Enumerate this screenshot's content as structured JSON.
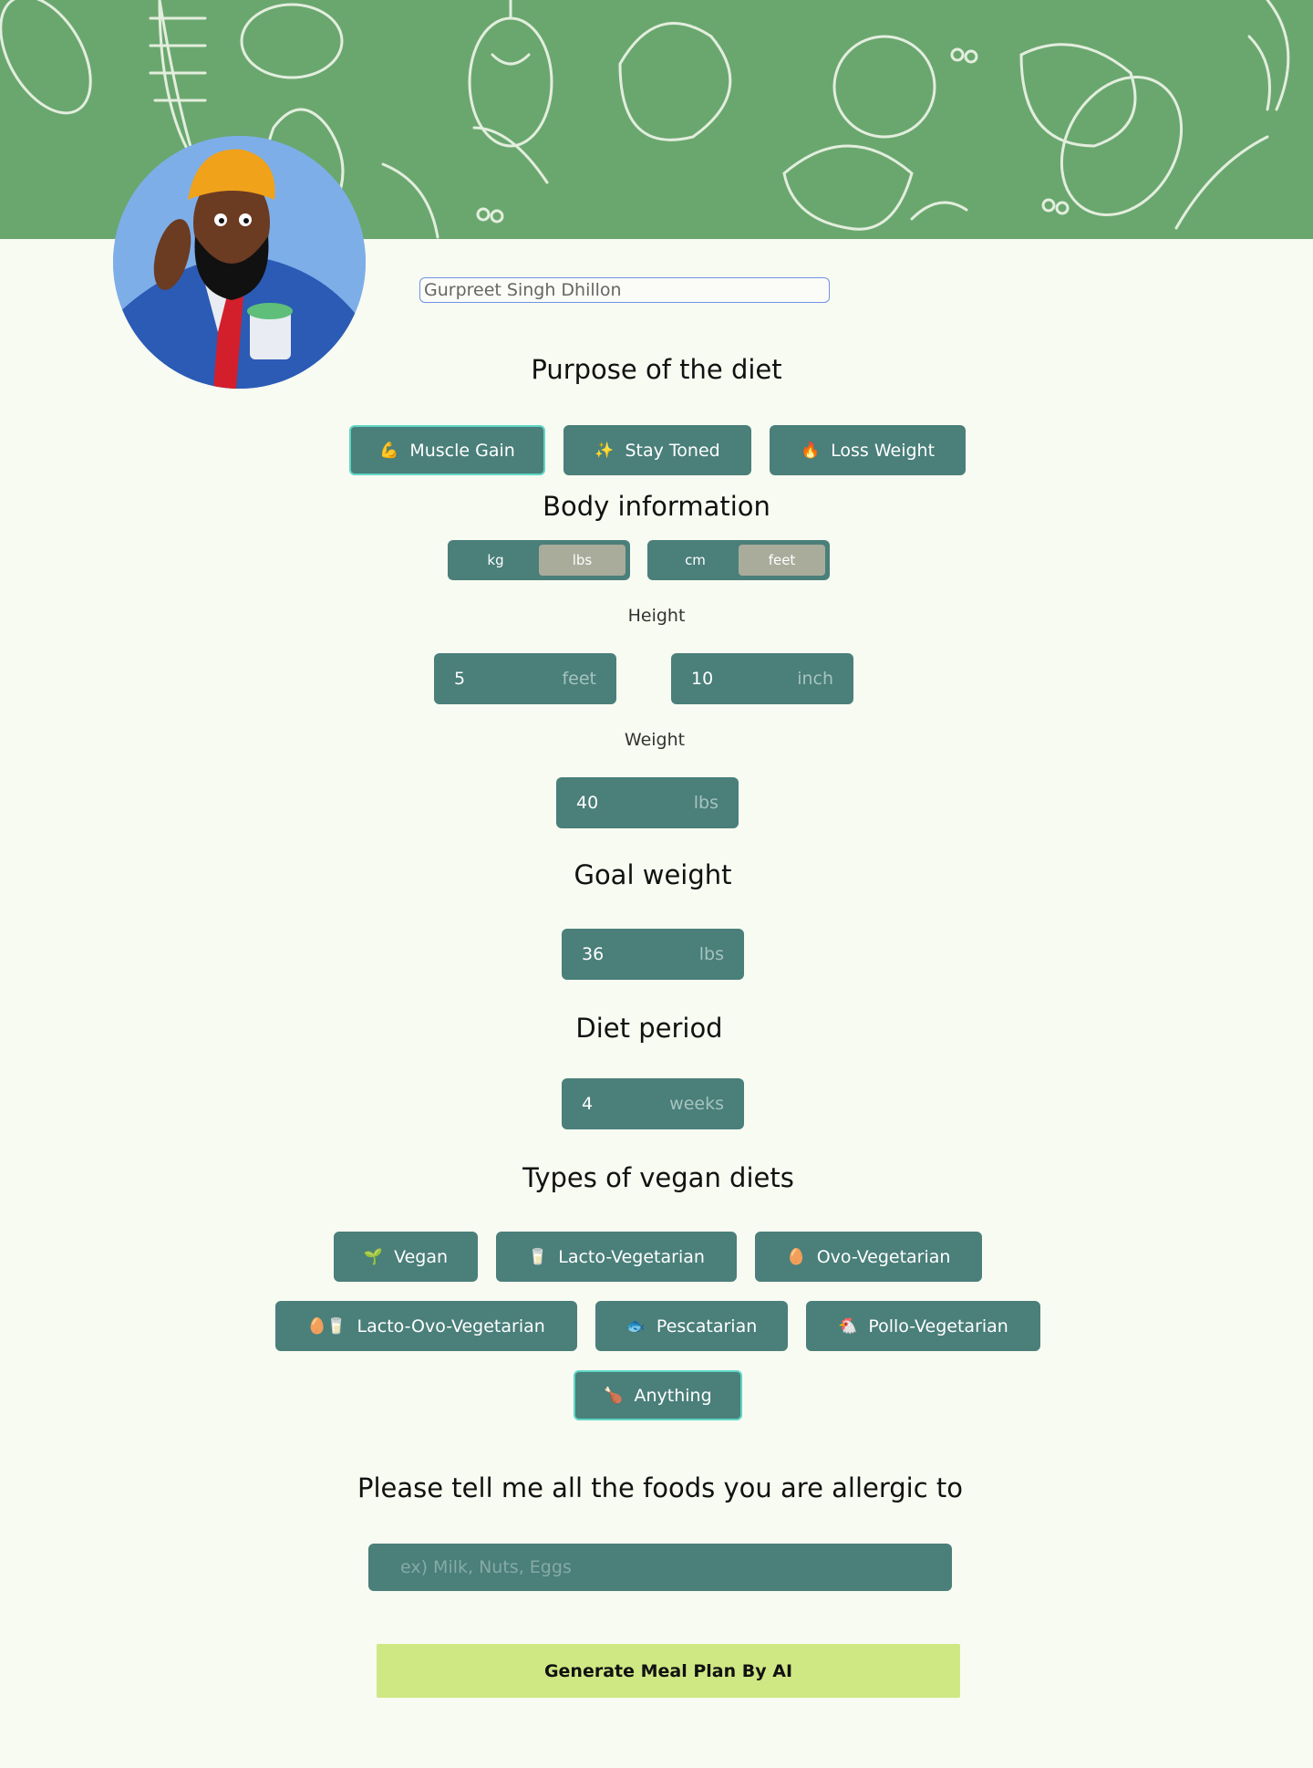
{
  "profile": {
    "name_value": "Gurpreet Singh Dhillon"
  },
  "purpose": {
    "heading": "Purpose of the diet",
    "options": [
      {
        "emoji": "💪",
        "label": "Muscle Gain",
        "selected": true
      },
      {
        "emoji": "✨",
        "label": "Stay Toned",
        "selected": false
      },
      {
        "emoji": "🔥",
        "label": "Loss Weight",
        "selected": false
      }
    ]
  },
  "body": {
    "heading": "Body information",
    "weight_units": {
      "options": [
        "kg",
        "lbs"
      ],
      "selected": "lbs"
    },
    "height_units": {
      "options": [
        "cm",
        "feet"
      ],
      "selected": "feet"
    },
    "height_label": "Height",
    "height_feet": {
      "value": "5",
      "unit": "feet"
    },
    "height_inch": {
      "value": "10",
      "unit": "inch"
    },
    "weight_label": "Weight",
    "weight": {
      "value": "40",
      "unit": "lbs"
    }
  },
  "goal": {
    "heading": "Goal weight",
    "value": "36",
    "unit": "lbs"
  },
  "period": {
    "heading": "Diet period",
    "value": "4",
    "unit": "weeks"
  },
  "diets": {
    "heading": "Types of vegan diets",
    "options": [
      {
        "emoji": "🌱",
        "label": "Vegan",
        "selected": false
      },
      {
        "emoji": "🥛",
        "label": "Lacto-Vegetarian",
        "selected": false
      },
      {
        "emoji": "🥚",
        "label": "Ovo-Vegetarian",
        "selected": false
      },
      {
        "emoji": "🥚🥛",
        "label": "Lacto-Ovo-Vegetarian",
        "selected": false
      },
      {
        "emoji": "🐟",
        "label": "Pescatarian",
        "selected": false
      },
      {
        "emoji": "🐔",
        "label": "Pollo-Vegetarian",
        "selected": false
      },
      {
        "emoji": "🍗",
        "label": "Anything",
        "selected": true
      }
    ]
  },
  "allergy": {
    "heading": "Please tell me all the foods you are allergic to",
    "placeholder": "ex) Milk, Nuts, Eggs"
  },
  "generate_label": "Generate Meal Plan By AI",
  "colors": {
    "background": "#f8fbf1",
    "banner": "#6aa76f",
    "button": "#4a7f7a",
    "selected_border": "#5fd6c5",
    "toggle_active": "#a9ac9b",
    "cta": "#cfe883"
  }
}
